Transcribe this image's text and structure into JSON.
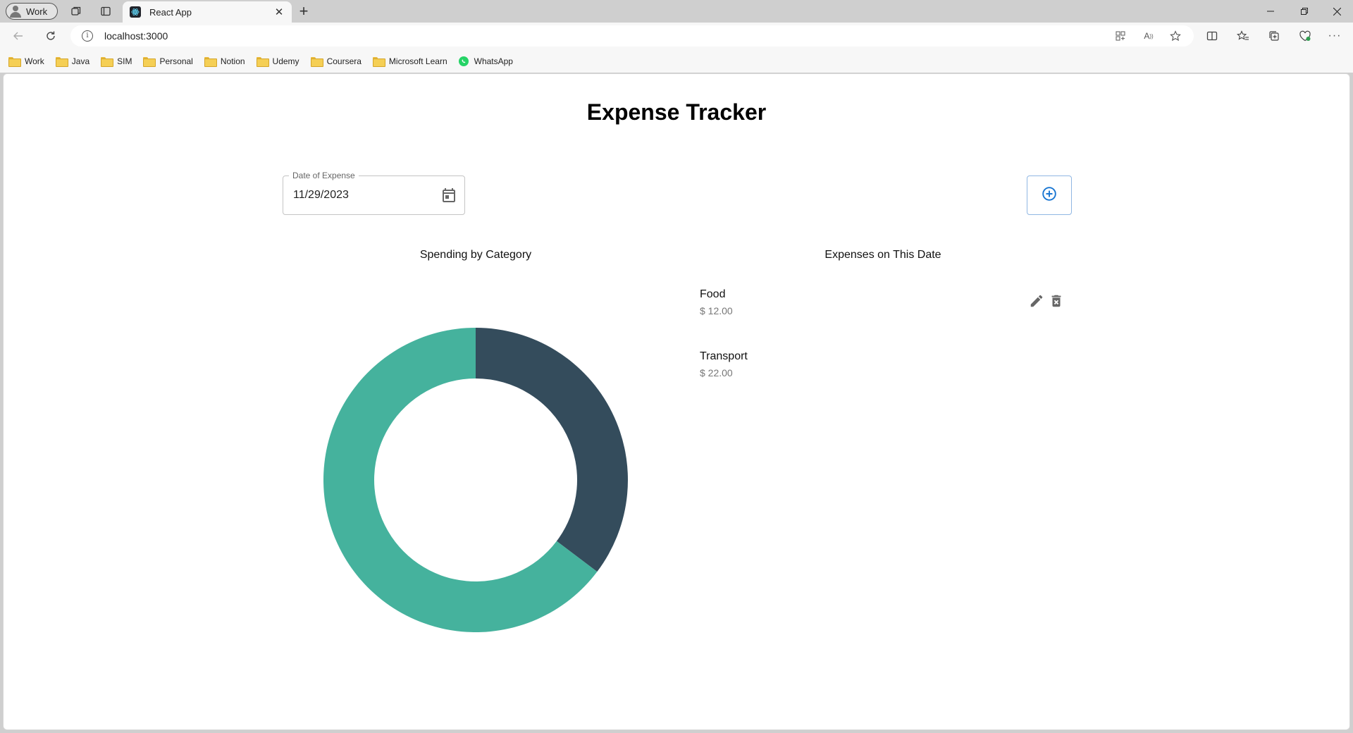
{
  "browser": {
    "profile_label": "Work",
    "tab_title": "React App",
    "url": "localhost:3000",
    "bookmarks": [
      {
        "label": "Work",
        "icon": "folder-icon"
      },
      {
        "label": "Java",
        "icon": "folder-icon"
      },
      {
        "label": "SIM",
        "icon": "folder-icon"
      },
      {
        "label": "Personal",
        "icon": "folder-icon"
      },
      {
        "label": "Notion",
        "icon": "folder-icon"
      },
      {
        "label": "Udemy",
        "icon": "folder-icon"
      },
      {
        "label": "Coursera",
        "icon": "folder-icon"
      },
      {
        "label": "Microsoft Learn",
        "icon": "folder-icon"
      },
      {
        "label": "WhatsApp",
        "icon": "whatsapp-icon"
      }
    ]
  },
  "app": {
    "title": "Expense Tracker",
    "date_field": {
      "label": "Date of Expense",
      "value": "11/29/2023"
    },
    "chart_title": "Spending by Category",
    "list_title": "Expenses on This Date",
    "expenses": [
      {
        "category": "Food",
        "amount": "$ 12.00"
      },
      {
        "category": "Transport",
        "amount": "$ 22.00"
      }
    ]
  },
  "chart_data": {
    "type": "pie",
    "categories": [
      "Food",
      "Transport"
    ],
    "values": [
      12,
      22
    ],
    "colors": [
      "#344c5c",
      "#45b29d"
    ]
  }
}
